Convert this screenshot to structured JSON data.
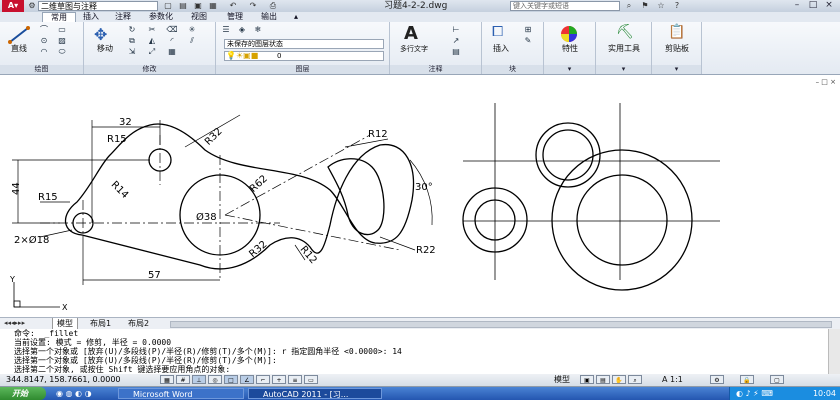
{
  "titlebar": {
    "workspace": "二维草图与注释",
    "document_title": "习题4-2-2.dwg",
    "search_placeholder": "键入关键字或短语"
  },
  "tabs": [
    "常用",
    "插入",
    "注释",
    "参数化",
    "视图",
    "管理",
    "输出"
  ],
  "active_tab": "常用",
  "ribbon": {
    "draw": {
      "label": "绘图",
      "line_label": "直线"
    },
    "modify": {
      "label": "修改",
      "move_label": "移动"
    },
    "layers": {
      "label": "图层",
      "layer_state": "未保存的图层状态",
      "current_layer": "0"
    },
    "annotation": {
      "label": "注释",
      "mtext_label": "多行文字"
    },
    "block": {
      "label": "块",
      "insert_label": "插入"
    },
    "properties": {
      "label": "特性"
    },
    "utilities": {
      "label": "实用工具"
    },
    "clipboard": {
      "label": "剪贴板"
    }
  },
  "drawing": {
    "dims": {
      "d32": "32",
      "r15_top": "R15",
      "r32": "R32",
      "r12": "R12",
      "r14": "R14",
      "r62": "R62",
      "d44": "44",
      "r15_left": "R15",
      "phi38": "Ø38",
      "angle30": "30°",
      "two_phi18": "2×Ø18",
      "r32_b": "R32",
      "r12_b": "R12",
      "r22": "R22",
      "d57": "57",
      "axis_y": "Y",
      "axis_x": "X"
    }
  },
  "layout_tabs": [
    "模型",
    "布局1",
    "布局2"
  ],
  "active_layout": "模型",
  "command_lines": [
    "命令:  _fillet",
    "当前设置: 模式 = 修剪, 半径 = 0.0000",
    "选择第一个对象或 [放弃(U)/多段线(P)/半径(R)/修剪(T)/多个(M)]: r 指定圆角半径 <0.0000>: 14",
    "选择第一个对象或 [放弃(U)/多段线(P)/半径(R)/修剪(T)/多个(M)]:",
    "选择第二个对象, 或按住 Shift 键选择要应用角点的对象:"
  ],
  "status": {
    "coords": "344.8147, 158.7661, 0.0000",
    "model_label": "模型",
    "annotation_scale": "A 1:1"
  },
  "taskbar": {
    "start_label": "开始",
    "tasks": [
      "Microsoft Word",
      "AutoCAD 2011 - [习..."
    ],
    "clock": "10:04"
  }
}
